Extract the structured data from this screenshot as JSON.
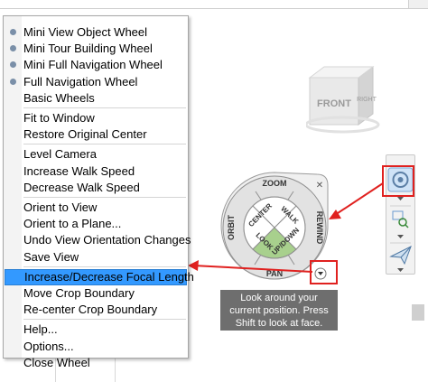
{
  "menu": {
    "items": [
      {
        "label": "Mini View Object Wheel",
        "dot": true
      },
      {
        "label": "Mini Tour Building Wheel",
        "dot": true
      },
      {
        "label": "Mini Full Navigation Wheel",
        "dot": true
      },
      {
        "label": "Full Navigation Wheel",
        "dot": true
      },
      {
        "label": "Basic Wheels",
        "dot": false
      },
      {
        "label": "Fit to Window",
        "dot": false
      },
      {
        "label": "Restore Original Center",
        "dot": false
      },
      {
        "label": "Level Camera",
        "dot": false
      },
      {
        "label": "Increase Walk Speed",
        "dot": false
      },
      {
        "label": "Decrease Walk Speed",
        "dot": false
      },
      {
        "label": "Orient to View",
        "dot": false
      },
      {
        "label": "Orient to a Plane...",
        "dot": false
      },
      {
        "label": "Undo View Orientation Changes",
        "dot": false
      },
      {
        "label": "Save View",
        "dot": false
      },
      {
        "label": "Increase/Decrease Focal Length",
        "dot": false,
        "highlighted": true
      },
      {
        "label": "Move Crop Boundary",
        "dot": false
      },
      {
        "label": "Re-center Crop Boundary",
        "dot": false
      },
      {
        "label": "Help...",
        "dot": false
      },
      {
        "label": "Options...",
        "dot": false
      },
      {
        "label": "Close Wheel",
        "dot": false
      }
    ]
  },
  "viewcube": {
    "front": "FRONT",
    "right": "RIGHT"
  },
  "wheel": {
    "zoom": "ZOOM",
    "rewind": "REWIND",
    "pan": "PAN",
    "orbit": "ORBIT",
    "center": "CENTER",
    "walk": "WALK",
    "look": "LOOK",
    "updown": "UP/DOWN"
  },
  "tooltip": {
    "lines": [
      "Look around your",
      "current position. Press",
      "Shift to look at face."
    ]
  },
  "colors": {
    "highlight": "#3399ff",
    "annotation": "#e0211f",
    "look_segment": "#a8d08d",
    "wheel_ring": "#e6e6e6"
  }
}
